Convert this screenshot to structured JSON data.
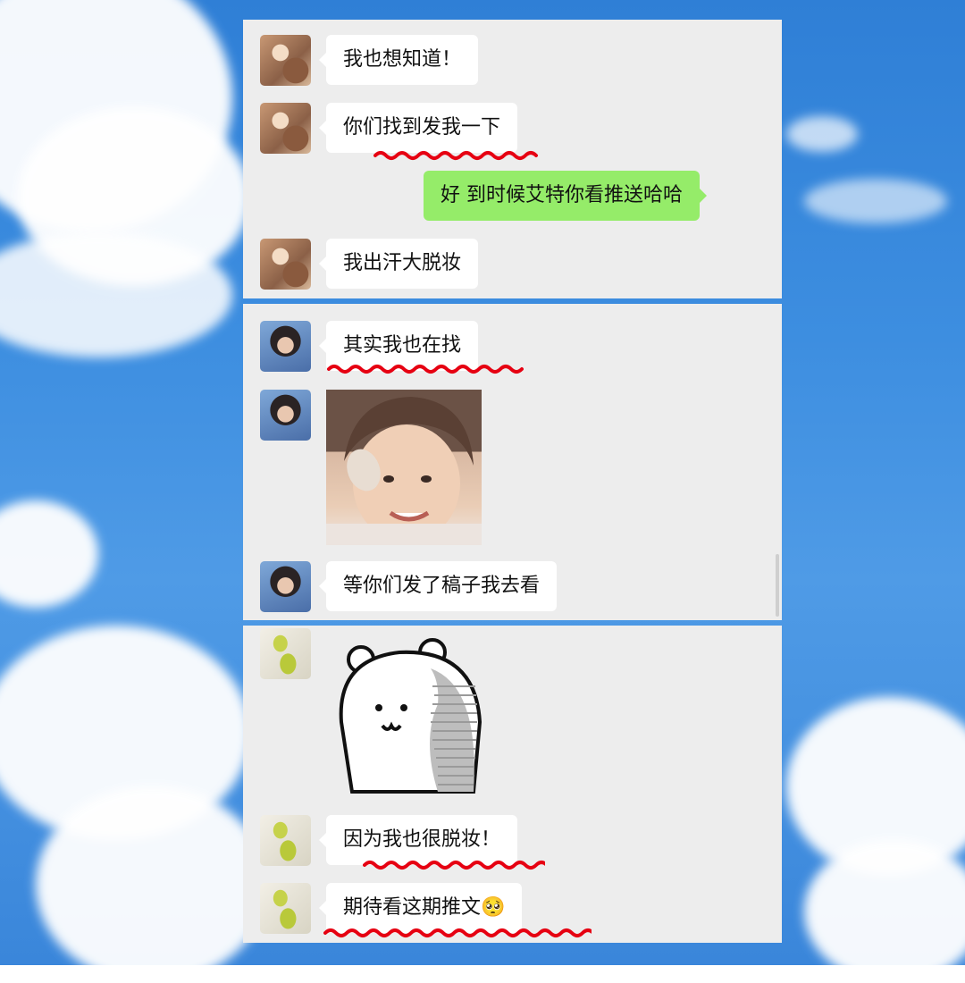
{
  "messages": {
    "m1": "我也想知道！",
    "m2": "你们找到发我一下",
    "m3": "好 到时候艾特你看推送哈哈",
    "m4": "我出汗大脱妆",
    "m5": "其实我也在找",
    "m7": "等你们发了稿子我去看",
    "m9": "因为我也很脱妆！",
    "m10": "期待看这期推文",
    "m10_emoji": "🥺"
  },
  "colors": {
    "sent_bubble": "#95ec69",
    "received_bubble": "#ffffff",
    "chat_background": "#ededed",
    "underline": "#e60012"
  },
  "icons": [
    "cat-avatar",
    "girl-avatar",
    "kiwi-avatar",
    "bear-sticker"
  ]
}
